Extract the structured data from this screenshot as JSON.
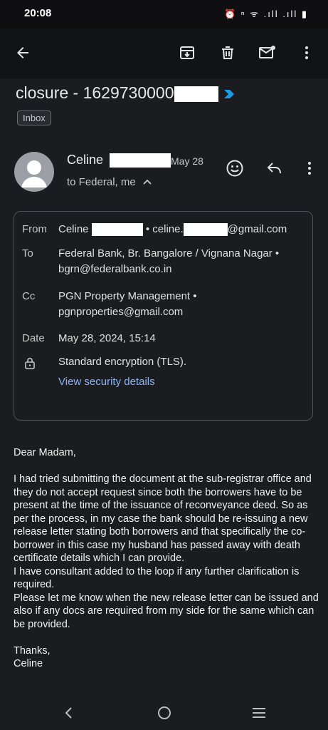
{
  "status": {
    "time": "20:08",
    "icons": "⏰ ⁿ ᯤ .ıll .ıll ▮"
  },
  "toolbar": {
    "back_icon": "arrow-left-icon",
    "archive_icon": "archive-icon",
    "delete_icon": "trash-icon",
    "mark_unread_icon": "mail-unread-icon",
    "more_icon": "more-vert-icon"
  },
  "email": {
    "subject": "closure - 1629730000",
    "label": "Inbox",
    "sender_name": "Celine",
    "date_short": "May 28",
    "to_summary": "to Federal, me",
    "details": {
      "from_label": "From",
      "from_name": "Celine",
      "from_email_prefix": "• celine.",
      "from_email_suffix": "@gmail.com",
      "to_label": "To",
      "to_line1": "Federal Bank, Br. Bangalore / Vignana Nagar •",
      "to_line2": "bgrn@federalbank.co.in",
      "cc_label": "Cc",
      "cc_line1": "PGN Property Management •",
      "cc_line2": "pgnproperties@gmail.com",
      "date_label": "Date",
      "date_value": "May 28, 2024, 15:14",
      "encryption": "Standard encryption (TLS).",
      "security_link": "View security details"
    },
    "body": {
      "greeting": "Dear Madam,",
      "para1": "I had tried submitting the document at the sub-registrar office and they do not accept request since both the borrowers have to be present at the time of the issuance of reconveyance deed. So as per the process,  in my case the bank should be re-issuing a new release letter stating both borrowers and that specifically the co-borrower in this case my husband has passed away with death certificate details which I can provide.",
      "para2": "I have consultant added to the loop if any further clarification is required.",
      "para3": "Please let me know when the new release letter can be issued and also if any docs are required from my side for the same which can be provided.",
      "closing": "Thanks,",
      "signature": "Celine"
    }
  },
  "colors": {
    "background": "#1b1c20",
    "link": "#8ab4f8",
    "chevron": "#1a9be6"
  }
}
